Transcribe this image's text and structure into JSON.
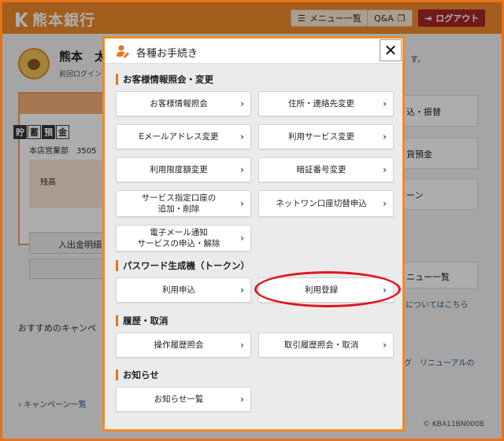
{
  "header": {
    "bank_name": "熊本銀行",
    "menu_label": "メニュー一覧",
    "qa_label": "Q&A",
    "logout_label": "ログアウト"
  },
  "background": {
    "user_name": "熊本　太",
    "last_login": "前回ログイン",
    "tail_text": "す。",
    "account_kanji": [
      "貯",
      "蓄",
      "預",
      "金"
    ],
    "branch": "本店営業部　3505",
    "balance_label": "残高",
    "btn_history": "入出金明細",
    "right_items": [
      "込・振替",
      "貨預金",
      "ーン",
      "ニュー一覧"
    ],
    "link_about": "についてはこちら",
    "recommend": "おすすめのキャンペ",
    "link_renewal": "グ　リニューアルの",
    "campaign_link": "キャンペーン一覧",
    "page_code": "KBA11BN000B"
  },
  "modal": {
    "title": "各種お手続き",
    "close_label": "✕",
    "sections": [
      {
        "title": "お客様情報照会・変更",
        "buttons": [
          "お客様情報照会",
          "住所・連絡先変更",
          "Eメールアドレス変更",
          "利用サービス変更",
          "利用限度額変更",
          "暗証番号変更",
          "サービス指定口座の\n追加・削除",
          "ネットワン口座切替申込",
          "電子メール通知\nサービスの申込・解除"
        ]
      },
      {
        "title": "パスワード生成機（トークン）",
        "buttons": [
          "利用申込",
          "利用登録"
        ]
      },
      {
        "title": "履歴・取消",
        "buttons": [
          "操作履歴照会",
          "取引履歴照会・取消"
        ]
      },
      {
        "title": "お知らせ",
        "buttons": [
          "お知らせ一覧"
        ]
      }
    ]
  },
  "colors": {
    "brand_orange": "#f08a2a",
    "logout_red": "#a5272a",
    "arrow_blue": "#1b5fa6",
    "highlight_red": "#e0161f"
  }
}
